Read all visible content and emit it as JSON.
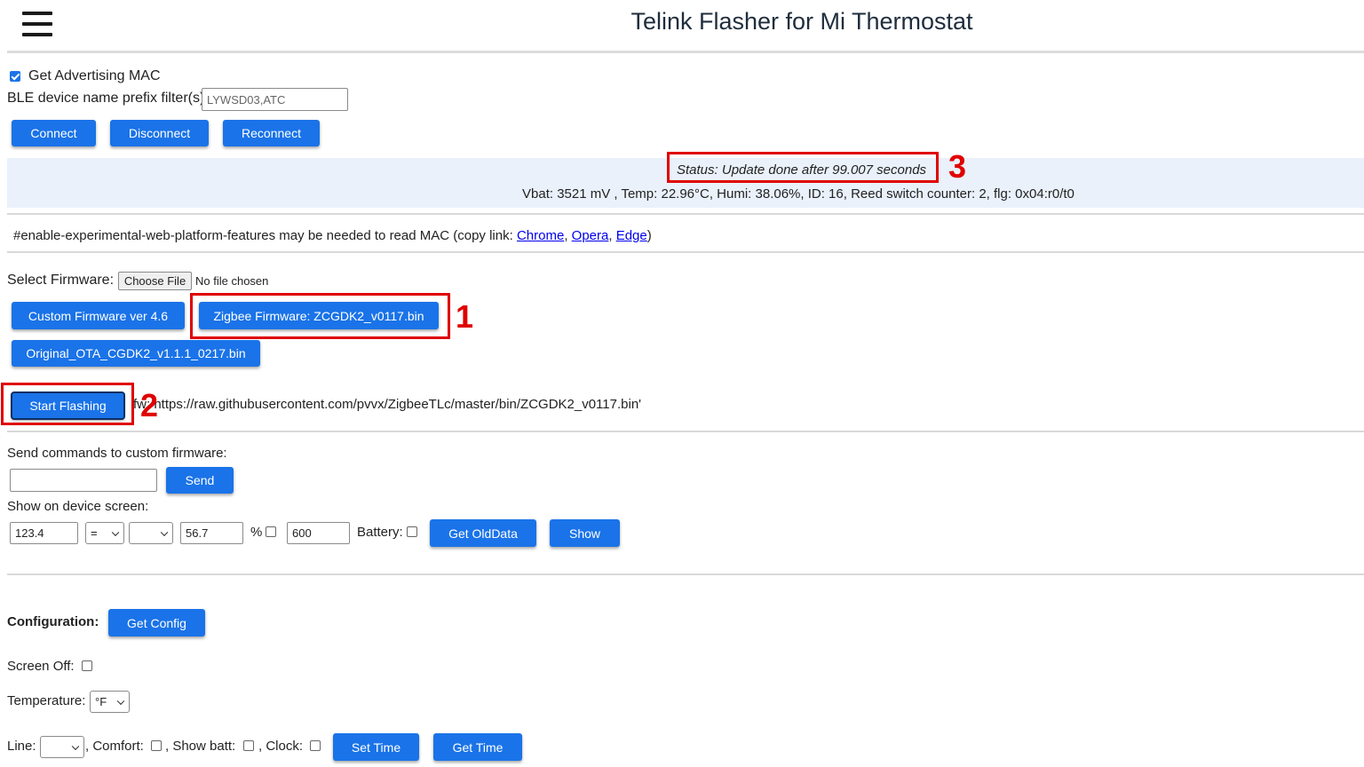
{
  "header": {
    "title": "Telink Flasher for Mi Thermostat",
    "menu_icon": "hamburger-menu-icon"
  },
  "connection": {
    "adv_mac_label": "Get Advertising MAC",
    "adv_mac_checked": true,
    "prefix_label": "BLE device name prefix filter(s)",
    "prefix_value": "LYWSD03,ATC",
    "connect": "Connect",
    "disconnect": "Disconnect",
    "reconnect": "Reconnect"
  },
  "status": {
    "text": "Status: Update done after 99.007 seconds",
    "readings": "Vbat: 3521 mV , Temp: 22.96°C, Humi: 38.06%, ID: 16, Reed switch counter: 2, flg: 0x04:r0/t0"
  },
  "notice": {
    "text": "#enable-experimental-web-platform-features may be needed to read MAC (copy link: ",
    "link_chrome": "Chrome",
    "sep1": ", ",
    "link_opera": "Opera",
    "sep2": ", ",
    "link_edge": "Edge",
    "close": ")"
  },
  "firmware": {
    "select_label": "Select Firmware:",
    "choose_file": "Choose File",
    "no_file": "No file chosen",
    "custom_btn": "Custom Firmware ver 4.6",
    "zigbee_btn": "Zigbee Firmware: ZCGDK2_v0117.bin",
    "original_btn": "Original_OTA_CGDK2_v1.1.1_0217.bin",
    "start_btn": "Start Flashing",
    "fw_url": "fw: https://raw.githubusercontent.com/pvvx/ZigbeeTLc/master/bin/ZCGDK2_v0117.bin'"
  },
  "commands": {
    "send_label": "Send commands to custom firmware:",
    "send_value": "",
    "send_btn": "Send",
    "show_label": "Show on device screen:",
    "val1": "123.4",
    "op": "=",
    "val2_select": "",
    "val3": "56.7",
    "percent": "%",
    "val4": "600",
    "battery_label": "Battery:",
    "get_old_btn": "Get OldData",
    "show_btn": "Show"
  },
  "config": {
    "label": "Configuration:",
    "get_config_btn": "Get Config",
    "screen_off_label": "Screen Off:",
    "temperature_label": "Temperature:",
    "temperature_unit": "°F",
    "line_label": "Line:",
    "line_value": "",
    "comfort_label": ", Comfort:",
    "show_batt_label": ", Show batt:",
    "clock_label": ", Clock:",
    "set_time_btn": "Set Time",
    "get_time_btn": "Get Time"
  },
  "annotations": {
    "n1": "1",
    "n2": "2",
    "n3": "3"
  },
  "colors": {
    "button": "#1a73e8",
    "annotation": "#e00000",
    "status_bg": "#eaf1fb"
  }
}
